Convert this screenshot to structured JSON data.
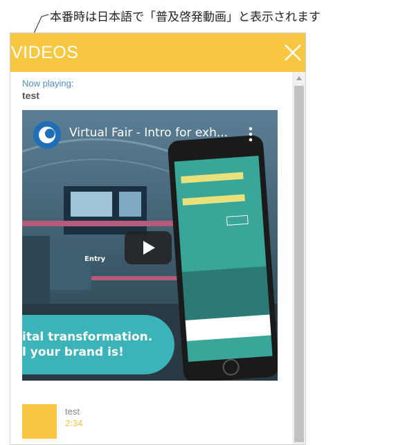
{
  "annotation": {
    "text": "本番時は日本語で「普及啓発動画」と表示されます"
  },
  "panel": {
    "title": "VIDEOS",
    "close_icon": "close-icon"
  },
  "now_playing": {
    "label": "Now playing:",
    "title": "test"
  },
  "video": {
    "title": "Virtual Fair - Intro for exh...",
    "menu_icon": "more-vertical-icon",
    "play_icon": "play-icon",
    "channel_logo_icon": "channel-logo-icon",
    "banner_lines": [
      "ital transformation.",
      "l your brand is!"
    ],
    "scene_label": "Entry"
  },
  "playlist": [
    {
      "title": "test",
      "duration": "2:34"
    }
  ],
  "colors": {
    "accent": "#f8c842",
    "link": "#4a8ed6",
    "teal": "#3bb3b8"
  }
}
